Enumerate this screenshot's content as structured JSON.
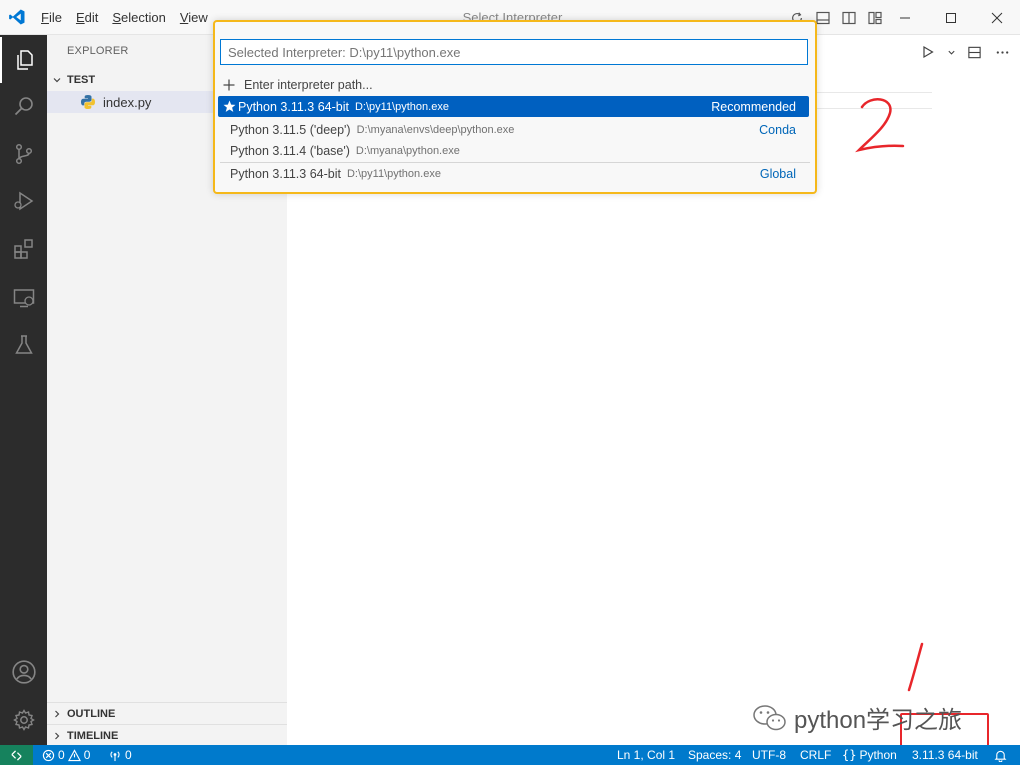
{
  "window": {
    "title": "Select Interpreter"
  },
  "menu": {
    "items": [
      {
        "mnemonic": "F",
        "rest": "ile"
      },
      {
        "mnemonic": "E",
        "rest": "dit"
      },
      {
        "mnemonic": "S",
        "rest": "election"
      },
      {
        "mnemonic": "V",
        "rest": "iew"
      }
    ]
  },
  "explorer": {
    "title": "EXPLORER",
    "folder": "TEST",
    "files": [
      "index.py"
    ],
    "outline": "OUTLINE",
    "timeline": "TIMELINE"
  },
  "quickpick": {
    "placeholder": "Selected Interpreter: D:\\py11\\python.exe",
    "enter_path": "Enter interpreter path...",
    "items": [
      {
        "label": "Python 3.11.3 64-bit",
        "path": "D:\\py11\\python.exe",
        "tag": "Recommended",
        "selected": true
      },
      {
        "label": "Python 3.11.5 ('deep')",
        "path": "D:\\myana\\envs\\deep\\python.exe",
        "tag": "Conda"
      },
      {
        "label": "Python 3.11.4 ('base')",
        "path": "D:\\myana\\python.exe",
        "tag": ""
      },
      {
        "label": "Python 3.11.3 64-bit",
        "path": "D:\\py11\\python.exe",
        "tag": "Global"
      }
    ]
  },
  "statusbar": {
    "errors": "0",
    "warnings": "0",
    "ports": "0",
    "position": "Ln 1, Col 1",
    "spaces": "Spaces: 4",
    "encoding": "UTF-8",
    "eol": "CRLF",
    "language": "Python",
    "interpreter": "3.11.3 64-bit"
  },
  "annotations": {
    "number_one": "1",
    "number_two": "2",
    "watermark": "python学习之旅"
  },
  "colors": {
    "accent": "#007acc",
    "selection": "#0060c0",
    "highlight_border": "#f5b81a",
    "annotation_red": "#e8262b",
    "remote": "#16825d"
  }
}
